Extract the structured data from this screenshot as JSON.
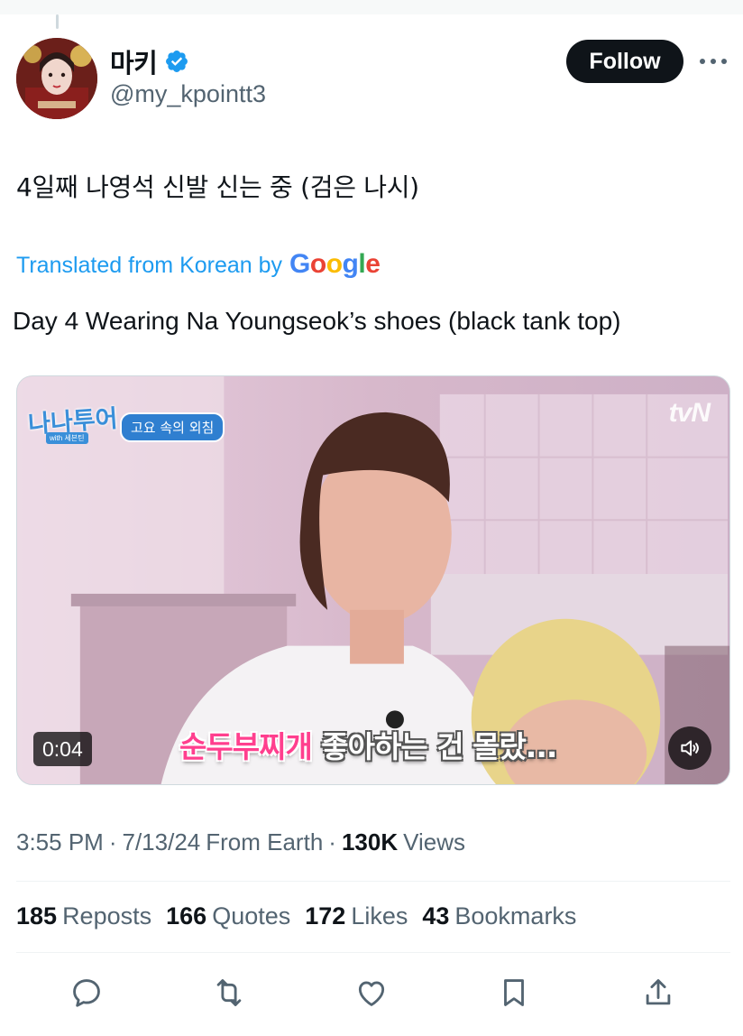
{
  "author": {
    "display_name": "마키",
    "handle": "@my_kpointt3",
    "verified": true
  },
  "follow_label": "Follow",
  "tweet": {
    "text": "4일째 나영석 신발 신는 중 (검은 나시)",
    "translated_by_label": "Translated from Korean by",
    "google_letters": [
      "G",
      "o",
      "o",
      "g",
      "l",
      "e"
    ],
    "translation": "Day 4 Wearing Na Youngseok’s shoes (black tank top)"
  },
  "media": {
    "type": "video",
    "duration": "0:04",
    "show_logo": "나나투어",
    "show_sub": "with 세븐틴",
    "episode_tag": "고요 속의 외침",
    "channel": "tvN",
    "subtitle_pink": "순두부찌개",
    "subtitle_rest": " 좋아하는 건 몰랐..."
  },
  "meta": {
    "time": "3:55 PM",
    "date": "7/13/24",
    "location": "From Earth",
    "views_count": "130K",
    "views_label": "Views"
  },
  "stats": [
    {
      "count": "185",
      "label": "Reposts"
    },
    {
      "count": "166",
      "label": "Quotes"
    },
    {
      "count": "172",
      "label": "Likes"
    },
    {
      "count": "43",
      "label": "Bookmarks"
    }
  ],
  "actions": [
    "reply-icon",
    "repost-icon",
    "like-icon",
    "bookmark-icon",
    "share-icon"
  ],
  "colors": {
    "accent": "#1d9bf0",
    "text": "#0f1419",
    "secondary": "#536471",
    "follow_bg": "#0f1419"
  }
}
